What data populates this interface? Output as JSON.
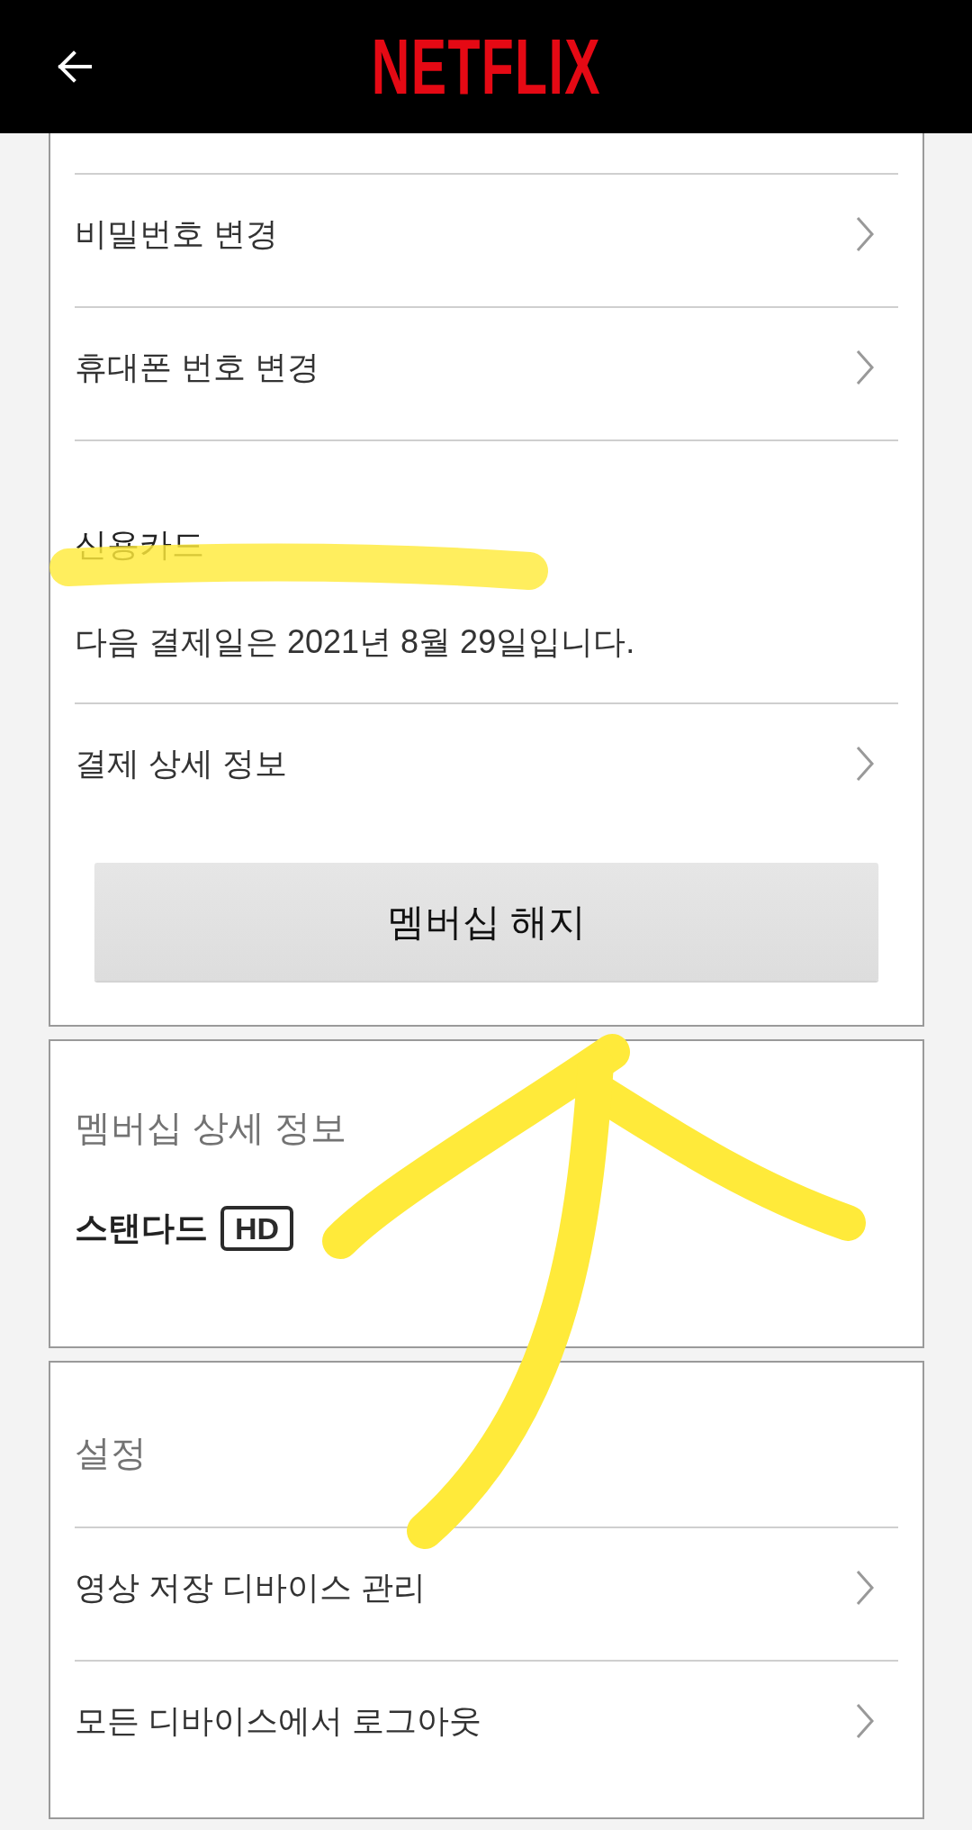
{
  "header": {
    "logo": "NETFLIX"
  },
  "account_card": {
    "rows": [
      {
        "label": "비밀번호 변경"
      },
      {
        "label": "휴대폰 번호 변경"
      }
    ],
    "payment": {
      "method": "신용카드",
      "next_billing": "다음 결제일은 2021년 8월 29일입니다."
    },
    "payment_rows": [
      {
        "label": "결제 상세 정보"
      }
    ],
    "cancel_button": "멤버십 해지"
  },
  "plan_card": {
    "title": "멤버십 상세 정보",
    "plan": "스탠다드",
    "badge": "HD"
  },
  "settings_card": {
    "title": "설정",
    "rows": [
      {
        "label": "영상 저장 디바이스 관리"
      },
      {
        "label": "모든 디바이스에서 로그아웃"
      }
    ]
  }
}
